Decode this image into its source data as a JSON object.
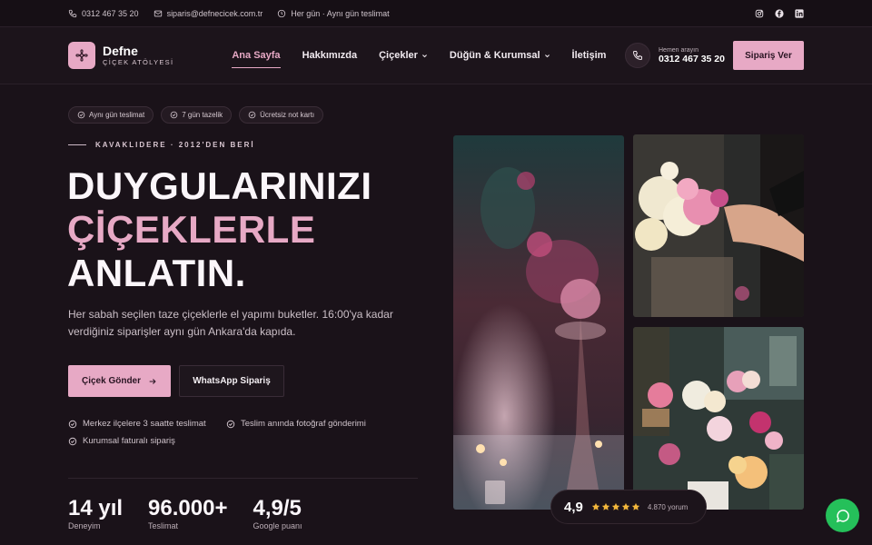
{
  "topbar": {
    "phone": "0312 467 35 20",
    "email": "siparis@defnecicek.com.tr",
    "hours": "Her gün · Aynı gün teslimat"
  },
  "header": {
    "brand_name": "Defne",
    "brand_sub": "ÇİÇEK ATÖLYESİ",
    "nav": [
      {
        "label": "Ana Sayfa"
      },
      {
        "label": "Hakkımızda"
      },
      {
        "label": "Çiçekler"
      },
      {
        "label": "Düğün & Kurumsal"
      },
      {
        "label": "İletişim"
      }
    ],
    "call_label": "Hemen arayın",
    "call_number": "0312 467 35 20",
    "order_label": "Sipariş Ver"
  },
  "hero": {
    "chips": [
      "Aynı gün teslimat",
      "7 gün tazelik",
      "Ücretsiz not kartı"
    ],
    "eyebrow": "KAVAKLIDERE · 2012'DEN BERİ",
    "headline_1": "DUYGULARINIZI",
    "headline_2": "ÇİÇEKLERLE",
    "headline_3": "ANLATIN.",
    "description": "Her sabah seçilen taze çiçeklerle el yapımı buketler. 16:00'ya kadar verdiğiniz siparişler aynı gün Ankara'da kapıda.",
    "primary_cta": "Çiçek Gönder",
    "secondary_cta": "WhatsApp Sipariş",
    "features": [
      "Merkez ilçelere 3 saatte teslimat",
      "Teslim anında fotoğraf gönderimi",
      "Kurumsal faturalı sipariş"
    ],
    "stats": [
      {
        "value": "14 yıl",
        "label": "Deneyim"
      },
      {
        "value": "96.000+",
        "label": "Teslimat"
      },
      {
        "value": "4,9/5",
        "label": "Google puanı"
      }
    ]
  },
  "rating": {
    "value": "4,9",
    "count": "4.870 yorum",
    "stars": 5
  },
  "colors": {
    "accent": "#e7a9c5",
    "background": "#1a1219",
    "whatsapp": "#25c05a"
  }
}
